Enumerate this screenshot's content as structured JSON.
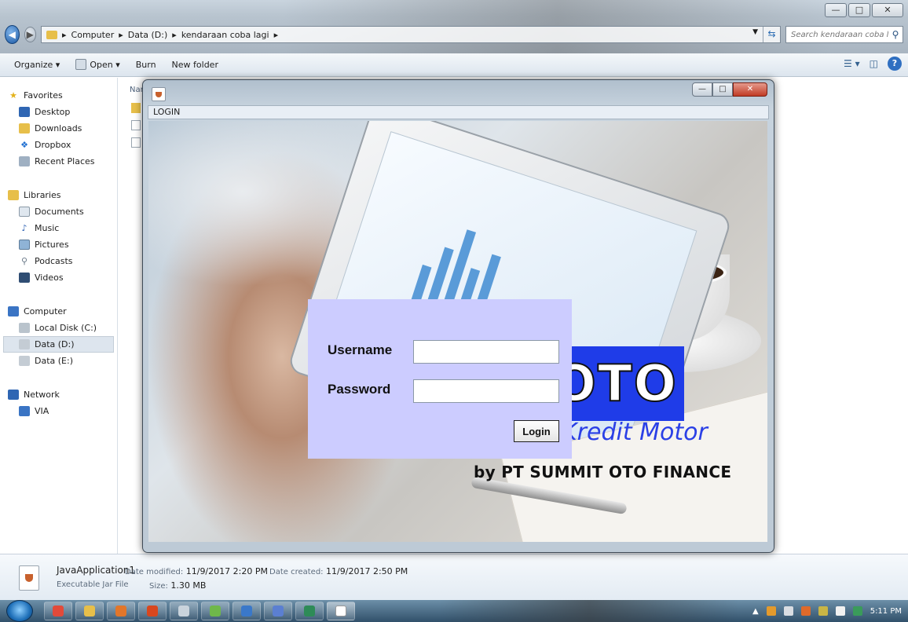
{
  "explorer": {
    "breadcrumb": [
      "Computer",
      "Data (D:)",
      "kendaraan coba lagi"
    ],
    "search_placeholder": "Search kendaraan coba lagi",
    "commands": [
      "Organize ▾",
      "Open ▾",
      "Burn",
      "New folder"
    ],
    "nav": {
      "favorites_header": "Favorites",
      "favorites": [
        "Desktop",
        "Downloads",
        "Dropbox",
        "Recent Places"
      ],
      "libraries_header": "Libraries",
      "libraries": [
        "Documents",
        "Music",
        "Pictures",
        "Podcasts",
        "Videos"
      ],
      "computer_header": "Computer",
      "computer": [
        "Local Disk (C:)",
        "Data (D:)",
        "Data (E:)"
      ],
      "network_header": "Network",
      "network": [
        "VIA"
      ]
    },
    "content_header_name": "Nam"
  },
  "details": {
    "name": "JavaApplication1",
    "modified_label": "Date modified:",
    "modified": "11/9/2017 2:20 PM",
    "created_label": "Date created:",
    "created": "11/9/2017 2:50 PM",
    "type": "Executable Jar File",
    "size_label": "Size:",
    "size": "1.30 MB"
  },
  "dialog": {
    "menu_title": "LOGIN",
    "username_label": "Username",
    "password_label": "Password",
    "username_value": "",
    "password_value": "",
    "login_button": "Login",
    "logo": {
      "oto": "OTO",
      "kredit": "Kredit Motor",
      "by": "by PT SUMMIT OTO FINANCE"
    }
  },
  "taskbar": {
    "clock": "5:11 PM"
  },
  "colors": {
    "login_panel": "#ccccff",
    "logo_blue": "#1f3ce8"
  }
}
